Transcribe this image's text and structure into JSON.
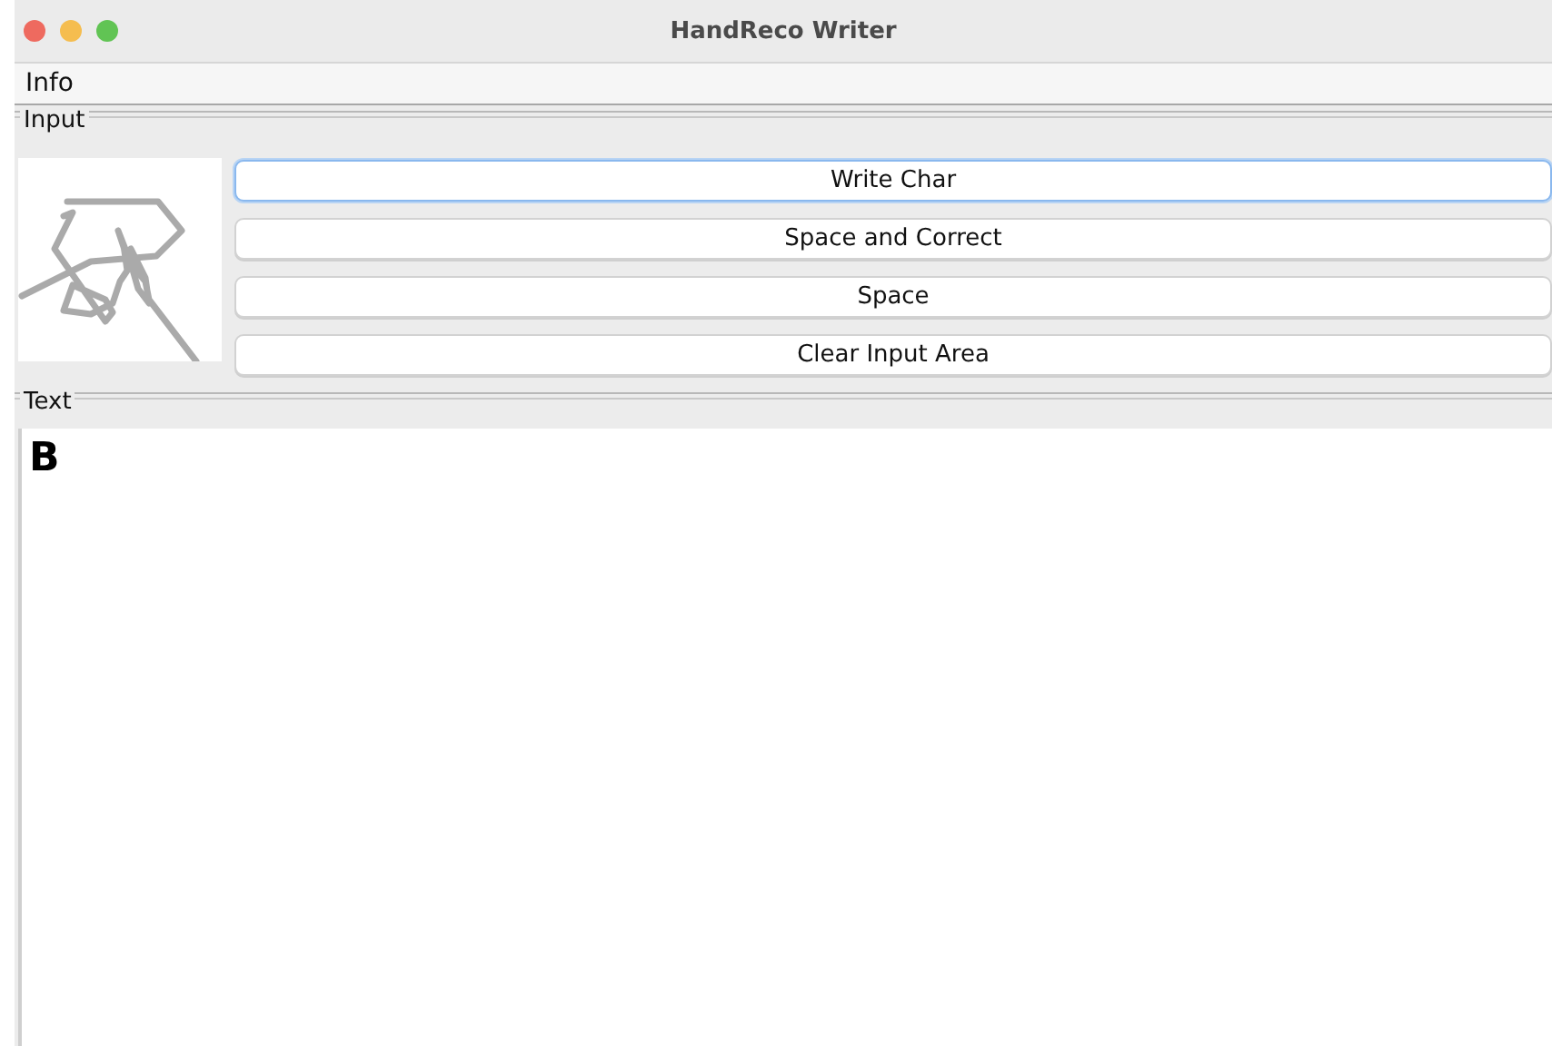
{
  "window": {
    "title": "HandReco Writer"
  },
  "menu": [
    "Info"
  ],
  "input_panel": {
    "title": "Input",
    "buttons": [
      {
        "label": "Write Char",
        "focused": true
      },
      {
        "label": "Space and Correct",
        "focused": false
      },
      {
        "label": "Space",
        "focused": false
      },
      {
        "label": "Clear Input Area",
        "focused": false
      }
    ]
  },
  "text_panel": {
    "title": "Text",
    "content": "B"
  }
}
